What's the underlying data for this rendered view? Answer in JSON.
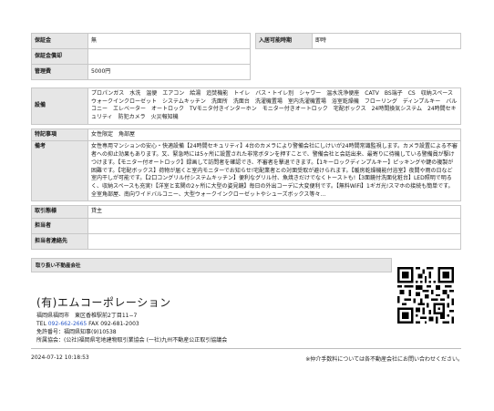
{
  "rows_top": [
    {
      "label": "保証金",
      "value": "無",
      "label2": "入居可能時期",
      "value2": "即時"
    },
    {
      "label": "保証金償却",
      "value": ""
    },
    {
      "label": "管理費",
      "value": "5000円"
    }
  ],
  "rows_main": [
    {
      "label": "設備",
      "value": "プロパンガス　水洗　温便　エアコン　給湯　追焚機能　トイレ　バス・トイレ別　シャワー　温水洗浄便座　CATV　BS端子　CS　収納スペース　ウォークインクローゼット　システムキッチン　洗面所　洗面台　洗濯機置場　室内洗濯機置場　浴室乾燥機　フローリング　ディンプルキー　バルコニー　エレベーター　オートロック　TVモニタ付きインターホン　モニター付きオートロック　宅配ボックス　24時間換気システム　24時間セキュリティ　防犯カメラ　火災報知機"
    },
    {
      "label": "特記事項",
      "value": "女性限定　角部屋"
    },
    {
      "label": "備考",
      "value": "女性専用マンションの安心・快適設備【24時間セキュリティ】4台のカメラにより警備会社にしけいが24時間常識監視します。カメラ設置による不審者への抑止効果もあります。又、緊急時には5ヶ所に設置された非常ボタンを押すことで、警備会社と会話出来、最寄りに待機している警備員が駆けつけます。【モニター付オートロック】録画して訪問者を確認でき、不審者を撃退できます。【1キーロックディンプルキー】ピッキングや鍵の複製が困難です。【宅配ボックス】荷物が届くと室内モニターでお知らせ!宅配業者との対面受取が避けられます。【暖房乾燥機能付浴室】夜間や雨の日など室内干しが可能です。【2口コングリル付システムキッチン】便利なグリル付、魚焼きだけでなくトーストも!【3面鏡付洗面化粧台】LED照明で明るく、収納スペースも充実!【洋室と玄関の2ヶ所に大型の姿見鏡】毎日の外出コーデに大変便利です。【無料WiFi】1ギガ光!スマホの接続も簡単です。全室角部屋、南向ワイドバルコニー、大型ウォークインクローゼットやシューズボックス等々…"
    },
    {
      "label": "取引態様",
      "value": "貸主"
    },
    {
      "label": "担当者",
      "value": ""
    },
    {
      "label": "担当者連絡先",
      "value": ""
    }
  ],
  "section_title": "取り扱い不動産会社",
  "company": {
    "name": "(有)エムコーポレーション",
    "address": "福岡県福岡市　東区香椎駅前2丁目11−7",
    "tel_label": "TEL",
    "tel": "092-662-2665",
    "fax": "FAX 092-681-2003",
    "license": "免許番号：福岡県知事(9)10538",
    "association": "所属協会：(公社)福岡県宅地建物取引業協会 (一社)九州不動産公正取引協議会"
  },
  "footer": {
    "timestamp": "2024-07-12 10:18:53",
    "note": "※仲介手数料については各不動産会社にお問い合わせください。"
  },
  "colors": {
    "label_bg": "#e6e6e6",
    "border": "#c8c8c8",
    "tel": "#2a59c8"
  },
  "icons": [
    "qr-code-icon"
  ]
}
